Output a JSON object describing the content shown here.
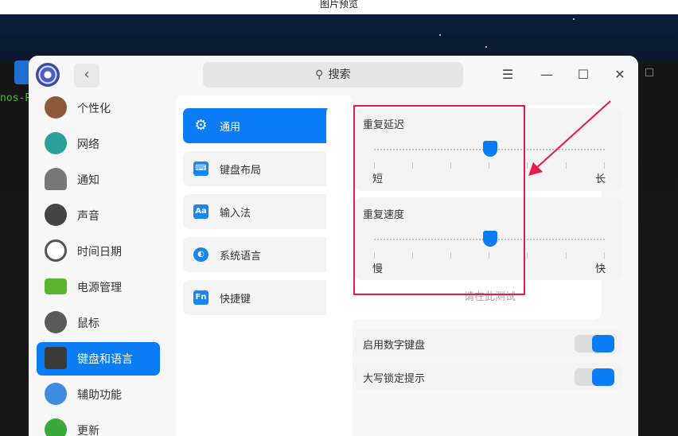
{
  "viewer": {
    "title": "图片预览"
  },
  "terminal": {
    "prompt_fragment": "nos-P"
  },
  "window": {
    "search_placeholder": "搜索",
    "buttons": {
      "menu": "☰",
      "minimize": "—",
      "maximize": "☐",
      "close": "✕",
      "back": "‹"
    }
  },
  "sidebar": {
    "items": [
      {
        "label": "个性化",
        "icon": "palette-icon",
        "color": "#8a5a3b"
      },
      {
        "label": "网络",
        "icon": "network-icon",
        "color": "#2aa198"
      },
      {
        "label": "通知",
        "icon": "bell-icon",
        "color": "#666666"
      },
      {
        "label": "声音",
        "icon": "speaker-icon",
        "color": "#444444"
      },
      {
        "label": "时间日期",
        "icon": "clock-icon",
        "color": "#555555"
      },
      {
        "label": "电源管理",
        "icon": "battery-icon",
        "color": "#5cb531"
      },
      {
        "label": "鼠标",
        "icon": "mouse-icon",
        "color": "#5a5a5a"
      },
      {
        "label": "键盘和语言",
        "icon": "keyboard-icon",
        "color": "#3a3a3a",
        "active": true
      },
      {
        "label": "辅助功能",
        "icon": "accessibility-icon",
        "color": "#3c8de0"
      },
      {
        "label": "更新",
        "icon": "update-icon",
        "color": "#3aa83a"
      }
    ]
  },
  "submenu": {
    "items": [
      {
        "label": "通用",
        "icon": "gear-icon",
        "glyph": "⚙",
        "active": true
      },
      {
        "label": "键盘布局",
        "icon": "keyboard-layout-icon",
        "glyph": "⌨"
      },
      {
        "label": "输入法",
        "icon": "input-method-icon",
        "glyph": "Aa"
      },
      {
        "label": "系统语言",
        "icon": "globe-icon",
        "glyph": "◐"
      },
      {
        "label": "快捷键",
        "icon": "shortcut-icon",
        "glyph": "Fn"
      }
    ]
  },
  "general": {
    "repeat_delay": {
      "title": "重复延迟",
      "min_label": "短",
      "max_label": "长",
      "value": 0.5
    },
    "repeat_speed": {
      "title": "重复速度",
      "min_label": "慢",
      "max_label": "快",
      "value": 0.5
    },
    "test_placeholder": "请在此测试",
    "numlock": {
      "label": "启用数字键盘",
      "enabled": true
    },
    "capslock": {
      "label": "大写锁定提示",
      "enabled": true
    }
  },
  "colors": {
    "accent": "#0a7cf5",
    "annotation": "#e8194f"
  }
}
